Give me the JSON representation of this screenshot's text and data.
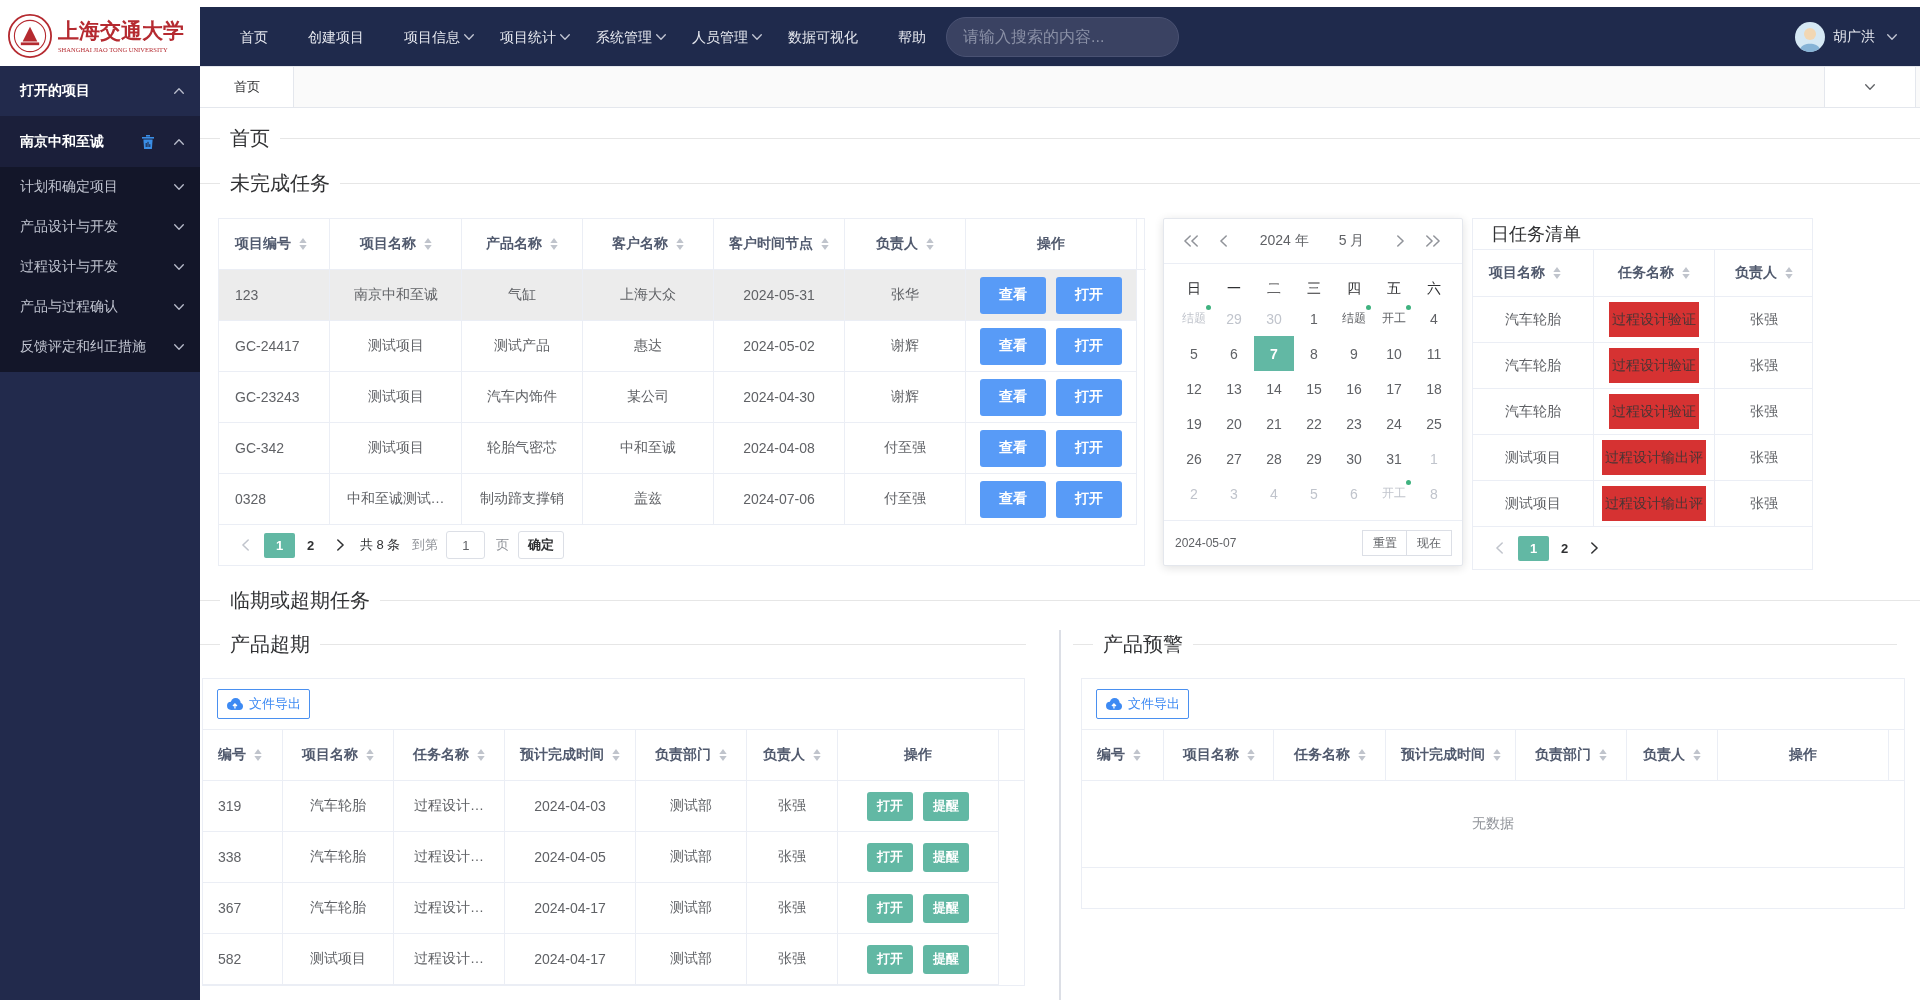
{
  "header": {
    "logo": {
      "title": "上海交通大学",
      "subtitle": "SHANGHAI JIAO TONG UNIVERSITY"
    },
    "nav": [
      {
        "label": "首页",
        "dropdown": false
      },
      {
        "label": "创建项目",
        "dropdown": false
      },
      {
        "label": "项目信息",
        "dropdown": true
      },
      {
        "label": "项目统计",
        "dropdown": true
      },
      {
        "label": "系统管理",
        "dropdown": true
      },
      {
        "label": "人员管理",
        "dropdown": true
      },
      {
        "label": "数据可视化",
        "dropdown": false
      },
      {
        "label": "帮助",
        "dropdown": false
      }
    ],
    "search": {
      "placeholder": "请输入搜索的内容..."
    },
    "user": {
      "name": "胡广洪"
    }
  },
  "sidebar": {
    "title": "打开的项目",
    "expanded": true,
    "items": [
      {
        "label": "南京中和至诚",
        "expanded": true,
        "children": [
          {
            "label": "计划和确定项目",
            "expanded": false
          },
          {
            "label": "产品设计与开发",
            "expanded": false
          },
          {
            "label": "过程设计与开发",
            "expanded": false
          },
          {
            "label": "产品与过程确认",
            "expanded": false
          },
          {
            "label": "反馈评定和纠正措施",
            "expanded": false
          }
        ]
      }
    ]
  },
  "tabs": [
    {
      "label": "首页",
      "selected": true
    }
  ],
  "page_title": "首页",
  "tasks": {
    "title": "未完成任务",
    "columns": [
      {
        "label": "项目编号",
        "sortable": true
      },
      {
        "label": "项目名称",
        "sortable": true
      },
      {
        "label": "产品名称",
        "sortable": true
      },
      {
        "label": "客户名称",
        "sortable": true
      },
      {
        "label": "客户时间节点",
        "sortable": true
      },
      {
        "label": "负责人",
        "sortable": true
      },
      {
        "label": "操作",
        "sortable": false
      }
    ],
    "rows": [
      {
        "cells": [
          "123",
          "南京中和至诚",
          "气缸",
          "上海大众",
          "2024-05-31",
          "张华"
        ],
        "actions": [
          "查看",
          "打开"
        ],
        "selected": true
      },
      {
        "cells": [
          "GC-24417",
          "测试项目",
          "测试产品",
          "惠达",
          "2024-05-02",
          "谢辉"
        ],
        "actions": [
          "查看",
          "打开"
        ],
        "selected": false
      },
      {
        "cells": [
          "GC-23243",
          "测试项目",
          "汽车内饰件",
          "某公司",
          "2024-04-30",
          "谢辉"
        ],
        "actions": [
          "查看",
          "打开"
        ],
        "selected": false
      },
      {
        "cells": [
          "GC-342",
          "测试项目",
          "轮胎气密芯",
          "中和至诚",
          "2024-04-08",
          "付至强"
        ],
        "actions": [
          "查看",
          "打开"
        ],
        "selected": false
      },
      {
        "cells": [
          "0328",
          "中和至诚测试…",
          "制动蹄支撑销",
          "盖兹",
          "2024-07-06",
          "付至强"
        ],
        "actions": [
          "查看",
          "打开"
        ],
        "selected": false
      }
    ],
    "pagination": {
      "prev_disabled": true,
      "next_disabled": false,
      "pages": [
        {
          "label": "1",
          "selected": true
        },
        {
          "label": "2",
          "selected": false
        }
      ],
      "total": "共 8 条",
      "jump_label": "到第",
      "jump_value": "1",
      "jump_unit": "页",
      "confirm": "确定"
    }
  },
  "calendar": {
    "year": "2024 年",
    "month": "5 月",
    "weekdays": [
      "日",
      "一",
      "二",
      "三",
      "四",
      "五",
      "六"
    ],
    "weeks": [
      [
        {
          "label": "结题",
          "other_month": true,
          "selected": false,
          "has_event": true
        },
        {
          "label": "29",
          "other_month": true,
          "selected": false,
          "has_event": false
        },
        {
          "label": "30",
          "other_month": true,
          "selected": false,
          "has_event": false
        },
        {
          "label": "1",
          "other_month": false,
          "selected": false,
          "has_event": false
        },
        {
          "label": "结题",
          "other_month": false,
          "selected": false,
          "has_event": true
        },
        {
          "label": "开工",
          "other_month": false,
          "selected": false,
          "has_event": true
        },
        {
          "label": "4",
          "other_month": false,
          "selected": false,
          "has_event": false
        }
      ],
      [
        {
          "label": "5",
          "other_month": false,
          "selected": false,
          "has_event": false
        },
        {
          "label": "6",
          "other_month": false,
          "selected": false,
          "has_event": false
        },
        {
          "label": "7",
          "other_month": false,
          "selected": true,
          "has_event": false
        },
        {
          "label": "8",
          "other_month": false,
          "selected": false,
          "has_event": false
        },
        {
          "label": "9",
          "other_month": false,
          "selected": false,
          "has_event": false
        },
        {
          "label": "10",
          "other_month": false,
          "selected": false,
          "has_event": false
        },
        {
          "label": "11",
          "other_month": false,
          "selected": false,
          "has_event": false
        }
      ],
      [
        {
          "label": "12",
          "other_month": false,
          "selected": false,
          "has_event": false
        },
        {
          "label": "13",
          "other_month": false,
          "selected": false,
          "has_event": false
        },
        {
          "label": "14",
          "other_month": false,
          "selected": false,
          "has_event": false
        },
        {
          "label": "15",
          "other_month": false,
          "selected": false,
          "has_event": false
        },
        {
          "label": "16",
          "other_month": false,
          "selected": false,
          "has_event": false
        },
        {
          "label": "17",
          "other_month": false,
          "selected": false,
          "has_event": false
        },
        {
          "label": "18",
          "other_month": false,
          "selected": false,
          "has_event": false
        }
      ],
      [
        {
          "label": "19",
          "other_month": false,
          "selected": false,
          "has_event": false
        },
        {
          "label": "20",
          "other_month": false,
          "selected": false,
          "has_event": false
        },
        {
          "label": "21",
          "other_month": false,
          "selected": false,
          "has_event": false
        },
        {
          "label": "22",
          "other_month": false,
          "selected": false,
          "has_event": false
        },
        {
          "label": "23",
          "other_month": false,
          "selected": false,
          "has_event": false
        },
        {
          "label": "24",
          "other_month": false,
          "selected": false,
          "has_event": false
        },
        {
          "label": "25",
          "other_month": false,
          "selected": false,
          "has_event": false
        }
      ],
      [
        {
          "label": "26",
          "other_month": false,
          "selected": false,
          "has_event": false
        },
        {
          "label": "27",
          "other_month": false,
          "selected": false,
          "has_event": false
        },
        {
          "label": "28",
          "other_month": false,
          "selected": false,
          "has_event": false
        },
        {
          "label": "29",
          "other_month": false,
          "selected": false,
          "has_event": false
        },
        {
          "label": "30",
          "other_month": false,
          "selected": false,
          "has_event": false
        },
        {
          "label": "31",
          "other_month": false,
          "selected": false,
          "has_event": false
        },
        {
          "label": "1",
          "other_month": true,
          "selected": false,
          "has_event": false
        }
      ],
      [
        {
          "label": "2",
          "other_month": true,
          "selected": false,
          "has_event": false
        },
        {
          "label": "3",
          "other_month": true,
          "selected": false,
          "has_event": false
        },
        {
          "label": "4",
          "other_month": true,
          "selected": false,
          "has_event": false
        },
        {
          "label": "5",
          "other_month": true,
          "selected": false,
          "has_event": false
        },
        {
          "label": "6",
          "other_month": true,
          "selected": false,
          "has_event": false
        },
        {
          "label": "开工",
          "other_month": true,
          "selected": false,
          "has_event": true
        },
        {
          "label": "8",
          "other_month": true,
          "selected": false,
          "has_event": false
        }
      ]
    ],
    "selected_date": "2024-05-07",
    "buttons": [
      "重置",
      "现在"
    ]
  },
  "daily_tasks": {
    "title": "日任务清单",
    "columns": [
      {
        "label": "项目名称",
        "sortable": true
      },
      {
        "label": "任务名称",
        "sortable": true
      },
      {
        "label": "负责人",
        "sortable": true
      }
    ],
    "rows": [
      {
        "project": "汽车轮胎",
        "task": "过程设计验证",
        "owner": "张强",
        "color": "#d63232"
      },
      {
        "project": "汽车轮胎",
        "task": "过程设计验证",
        "owner": "张强",
        "color": "#d63232"
      },
      {
        "project": "汽车轮胎",
        "task": "过程设计验证",
        "owner": "张强",
        "color": "#d63232"
      },
      {
        "project": "测试项目",
        "task": "过程设计输出评",
        "owner": "张强",
        "color": "#d63232"
      },
      {
        "project": "测试项目",
        "task": "过程设计输出评",
        "owner": "张强",
        "color": "#d63232"
      }
    ],
    "pagination": {
      "prev_disabled": true,
      "next_disabled": false,
      "pages": [
        {
          "label": "1",
          "selected": true
        },
        {
          "label": "2",
          "selected": false
        }
      ]
    }
  },
  "deadlines": {
    "title": "临期或超期任务",
    "panels": [
      {
        "title": "产品超期",
        "export": "文件导出",
        "columns": [
          {
            "label": "编号",
            "sortable": true
          },
          {
            "label": "项目名称",
            "sortable": true
          },
          {
            "label": "任务名称",
            "sortable": true
          },
          {
            "label": "预计完成时间",
            "sortable": true
          },
          {
            "label": "负责部门",
            "sortable": true
          },
          {
            "label": "负责人",
            "sortable": true
          },
          {
            "label": "操作",
            "sortable": false
          }
        ],
        "rows": [
          {
            "cells": [
              "319",
              "汽车轮胎",
              "过程设计…",
              "2024-04-03",
              "测试部",
              "张强"
            ],
            "actions": [
              "打开",
              "提醒"
            ]
          },
          {
            "cells": [
              "338",
              "汽车轮胎",
              "过程设计…",
              "2024-04-05",
              "测试部",
              "张强"
            ],
            "actions": [
              "打开",
              "提醒"
            ]
          },
          {
            "cells": [
              "367",
              "汽车轮胎",
              "过程设计…",
              "2024-04-17",
              "测试部",
              "张强"
            ],
            "actions": [
              "打开",
              "提醒"
            ]
          },
          {
            "cells": [
              "582",
              "测试项目",
              "过程设计…",
              "2024-04-17",
              "测试部",
              "张强"
            ],
            "actions": [
              "打开",
              "提醒"
            ]
          }
        ]
      },
      {
        "title": "产品预警",
        "export": "文件导出",
        "columns": [
          {
            "label": "编号",
            "sortable": true
          },
          {
            "label": "项目名称",
            "sortable": true
          },
          {
            "label": "任务名称",
            "sortable": true
          },
          {
            "label": "预计完成时间",
            "sortable": true
          },
          {
            "label": "负责部门",
            "sortable": true
          },
          {
            "label": "负责人",
            "sortable": true
          },
          {
            "label": "操作",
            "sortable": false
          }
        ],
        "empty_text": "无数据"
      }
    ]
  }
}
